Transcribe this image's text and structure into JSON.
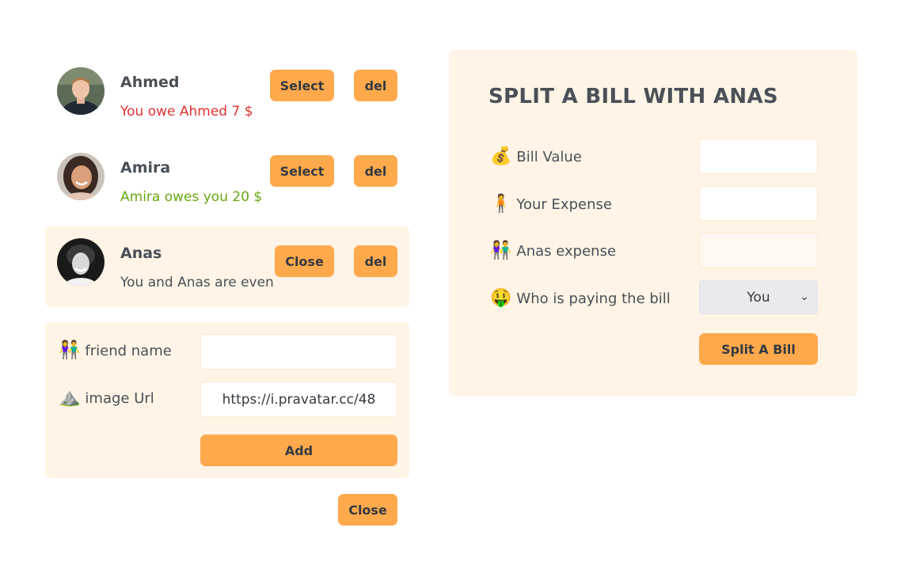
{
  "friends": [
    {
      "name": "Ahmed",
      "balance_text": "You owe Ahmed 7 $",
      "status": "owe",
      "action_label": "Select",
      "delete_label": "del"
    },
    {
      "name": "Amira",
      "balance_text": "Amira owes you 20 $",
      "status": "owed",
      "action_label": "Select",
      "delete_label": "del"
    },
    {
      "name": "Anas",
      "balance_text": "You and Anas are even",
      "status": "even",
      "action_label": "Close",
      "delete_label": "del",
      "selected": true
    }
  ],
  "add_friend_form": {
    "name_label": "friend name",
    "name_icon": "👫",
    "name_value": "",
    "image_label": "image Url",
    "image_icon": "⛰️",
    "image_value": "https://i.pravatar.cc/48",
    "add_label": "Add"
  },
  "close_form_label": "Close",
  "split_form": {
    "title": "SPLIT A BILL WITH ANAS",
    "bill_label": "Bill Value",
    "bill_icon": "💰",
    "bill_value": "",
    "your_expense_label": "Your Expense",
    "your_expense_icon": "🧍",
    "your_expense_value": "",
    "friend_expense_label": "Anas expense",
    "friend_expense_icon": "👫",
    "friend_expense_value": "",
    "payer_label": "Who is paying the bill",
    "payer_icon": "🤑",
    "payer_selected": "You",
    "submit_label": "Split A Bill"
  },
  "colors": {
    "accent": "#ffa94d",
    "panel": "#fff4e6",
    "owe": "#e03131",
    "owed": "#66a80f",
    "text": "#495057"
  }
}
